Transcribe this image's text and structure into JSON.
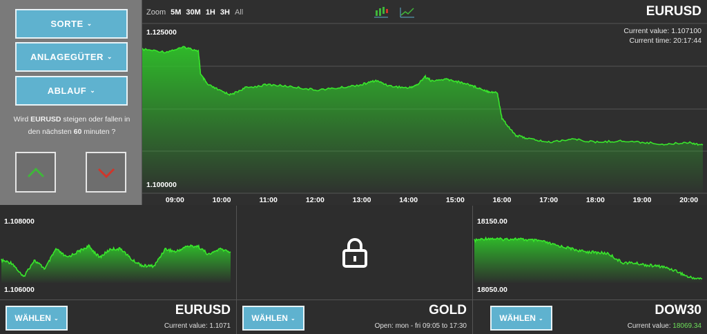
{
  "panel": {
    "buttons": [
      {
        "label": "SORTE"
      },
      {
        "label": "ANLAGEGÜTER"
      },
      {
        "label": "ABLAUF"
      }
    ],
    "question": {
      "pre": "Wird ",
      "symbol": "EURUSD",
      "mid": " steigen oder fallen in den nächsten ",
      "minutes": "60",
      "post": " minuten ?"
    },
    "up_color": "#3fb73a",
    "down_color": "#d0362a"
  },
  "main": {
    "zoom_label": "Zoom",
    "zoom_options": [
      "5M",
      "30M",
      "1H",
      "3H",
      "All"
    ],
    "symbol": "EURUSD",
    "current_value_label": "Current value:",
    "current_value": "1.107100",
    "current_time_label": "Current time:",
    "current_time": "20:17:44",
    "icons": [
      "candlestick-chart-icon",
      "line-chart-icon"
    ],
    "chart_data": {
      "type": "area",
      "ylim": [
        1.1,
        1.125
      ],
      "ytick_labels": [
        "1.125000",
        "1.100000"
      ],
      "xtick_labels": [
        "09:00",
        "10:00",
        "11:00",
        "12:00",
        "13:00",
        "14:00",
        "15:00",
        "16:00",
        "17:00",
        "18:00",
        "19:00",
        "20:00"
      ],
      "series": [
        {
          "x_hours": [
            8.3,
            8.8,
            9.2,
            9.5,
            9.55,
            9.7,
            10.0,
            10.2,
            10.5,
            11.0,
            11.5,
            12.0,
            12.5,
            13.0,
            13.3,
            13.6,
            14.0,
            14.2,
            14.35,
            14.5,
            14.8,
            15.0,
            15.3,
            15.5,
            15.7,
            15.9,
            16.0,
            16.3,
            16.6,
            17.0,
            17.5,
            18.0,
            18.5,
            19.0,
            19.5,
            20.0,
            20.3
          ],
          "values": [
            1.1212,
            1.1208,
            1.1215,
            1.121,
            1.1175,
            1.116,
            1.115,
            1.1145,
            1.1155,
            1.116,
            1.1157,
            1.1152,
            1.1155,
            1.116,
            1.1166,
            1.1158,
            1.1155,
            1.116,
            1.1172,
            1.1165,
            1.1168,
            1.1165,
            1.116,
            1.1155,
            1.115,
            1.1148,
            1.111,
            1.1085,
            1.108,
            1.1075,
            1.108,
            1.1075,
            1.1077,
            1.1075,
            1.1072,
            1.1075,
            1.1071
          ]
        }
      ],
      "line_color": "#39e62c",
      "grid": true
    }
  },
  "cards": [
    {
      "symbol": "EURUSD",
      "button": "WÄHLEN",
      "info_label": "Current value:",
      "info_value": "1.1071",
      "locked": false,
      "chart_data": {
        "type": "area",
        "ylim": [
          1.106,
          1.108
        ],
        "ytick_labels": [
          "1.108000",
          "1.106000"
        ],
        "series": [
          {
            "values": [
              1.1068,
              1.1067,
              1.1062,
              1.1068,
              1.1065,
              1.1072,
              1.1069,
              1.1071,
              1.1073,
              1.1069,
              1.1072,
              1.1072,
              1.1068,
              1.1066,
              1.1066,
              1.1072,
              1.1071,
              1.1073,
              1.1073,
              1.107,
              1.1072,
              1.1071
            ]
          }
        ]
      }
    },
    {
      "symbol": "GOLD",
      "button": "WÄHLEN",
      "info_label": "Open: mon - fri 09:05 to 17:30",
      "info_value": "",
      "locked": true
    },
    {
      "symbol": "DOW30",
      "button": "WÄHLEN",
      "info_label": "Current value:",
      "info_value": "18069.34",
      "locked": false,
      "chart_data": {
        "type": "area",
        "ylim": [
          18050,
          18150
        ],
        "ytick_labels": [
          "18150.00",
          "18050.00"
        ],
        "series": [
          {
            "values": [
              18125,
              18129,
              18127,
              18128,
              18126,
              18124,
              18117,
              18112,
              18106,
              18104,
              18102,
              18086,
              18085,
              18081,
              18079,
              18072,
              18060,
              18057
            ]
          }
        ]
      }
    }
  ]
}
